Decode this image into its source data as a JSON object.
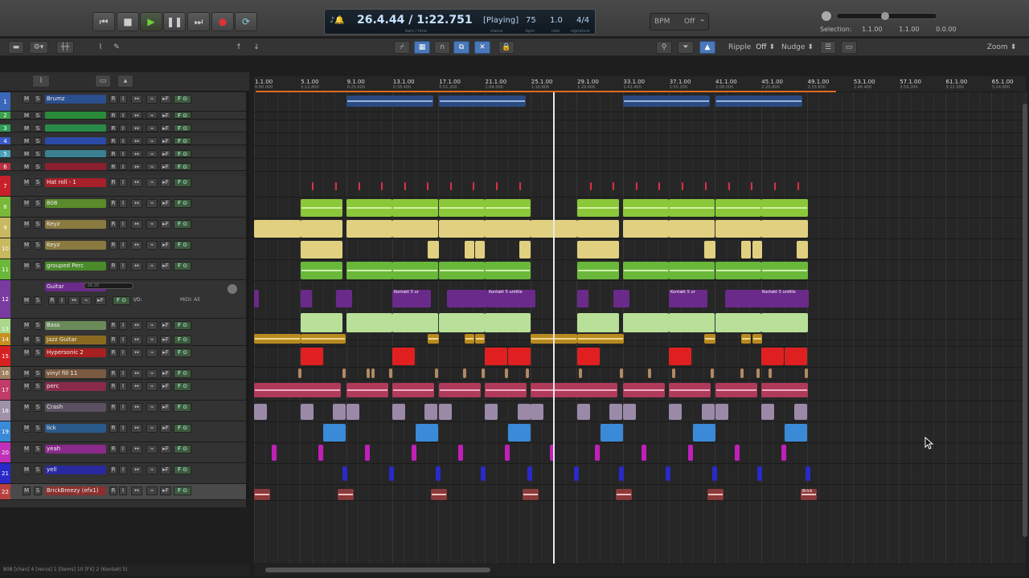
{
  "transport": {
    "rewind_icon": "rewind-icon",
    "stop_icon": "stop-icon",
    "play_icon": "play-icon",
    "pause_icon": "pause-icon",
    "forward_icon": "forward-icon",
    "record_icon": "record-icon",
    "loop_icon": "loop-icon",
    "time": "26.4.44 / 1:22.751",
    "time_sub": "bars / time",
    "status": "[Playing]",
    "status_lbl": "status",
    "bpm": "75",
    "bpm_lbl": "bpm",
    "rate": "1.0",
    "rate_lbl": "rate",
    "signature": "4/4",
    "signature_lbl": "signature",
    "bpm_btn": "BPM",
    "bpm_mode": "Off",
    "selection_label": "Selection:",
    "sel_start": "1.1.00",
    "sel_end": "1.1.00",
    "sel_len": "0.0.00"
  },
  "toolbar": {
    "ripple": "Ripple",
    "ripple_val": "Off",
    "nudge": "Nudge",
    "zoom": "Zoom"
  },
  "tracks": [
    {
      "num": "1",
      "name": "Brumz",
      "color": "#3a67b8",
      "namebg": "#2a4e8e"
    },
    {
      "num": "2",
      "name": "",
      "color": "#3aa04a",
      "namebg": "#2a8a3a"
    },
    {
      "num": "3",
      "name": "",
      "color": "#2f9a5a",
      "namebg": "#2a8a4a"
    },
    {
      "num": "4",
      "name": "",
      "color": "#3a5ac8",
      "namebg": "#2a4aa8"
    },
    {
      "num": "5",
      "name": "",
      "color": "#4aa0b8",
      "namebg": "#3a8090"
    },
    {
      "num": "6",
      "name": "",
      "color": "#b83040",
      "namebg": "#8a2030"
    },
    {
      "num": "7",
      "name": "Hat roll - 1",
      "color": "#c8202a",
      "namebg": "#a8202a"
    },
    {
      "num": "8",
      "name": "808",
      "color": "#7ab83a",
      "namebg": "#5a8a2a"
    },
    {
      "num": "9",
      "name": "Keyz",
      "color": "#c8b860",
      "namebg": "#8a7a40"
    },
    {
      "num": "10",
      "name": "Keyz",
      "color": "#c8b860",
      "namebg": "#8a7a40"
    },
    {
      "num": "11",
      "name": "grouped Perc",
      "color": "#6ab83a",
      "namebg": "#4a8a2a"
    },
    {
      "num": "12",
      "name": "Guitar",
      "color": "#7a3aa0",
      "namebg": "#6a2a8a"
    },
    {
      "num": "13",
      "name": "Bass",
      "color": "#a8d888",
      "namebg": "#6a8a5a"
    },
    {
      "num": "14",
      "name": "Jazz Guitar",
      "color": "#c89020",
      "namebg": "#8a6a20"
    },
    {
      "num": "15",
      "name": "Hypersonic 2",
      "color": "#d82020",
      "namebg": "#a82020"
    },
    {
      "num": "16",
      "name": "vinyl fill 11",
      "color": "#a08060",
      "namebg": "#7a5a40"
    },
    {
      "num": "17",
      "name": "perc",
      "color": "#c03a6a",
      "namebg": "#8a2a4a"
    },
    {
      "num": "18",
      "name": "Crash",
      "color": "#a090a8",
      "namebg": "#5a5060"
    },
    {
      "num": "19",
      "name": "lick",
      "color": "#3a8ad8",
      "namebg": "#2a5a8a"
    },
    {
      "num": "20",
      "name": "yeah",
      "color": "#c030b8",
      "namebg": "#8a2a8a"
    },
    {
      "num": "21",
      "name": "yell",
      "color": "#2a2ac8",
      "namebg": "#2a2aa0"
    },
    {
      "num": "22",
      "name": "BrickBreezy (efx1)",
      "color": "#b84040",
      "namebg": "#8a3030"
    }
  ],
  "ruler": [
    {
      "bar": "1.1.00",
      "time": "0:00.000"
    },
    {
      "bar": "5.1.00",
      "time": "0:12.800"
    },
    {
      "bar": "9.1.00",
      "time": "0:25.600"
    },
    {
      "bar": "13.1.00",
      "time": "0:38.400"
    },
    {
      "bar": "17.1.00",
      "time": "0:51.200"
    },
    {
      "bar": "21.1.00",
      "time": "1:04.000"
    },
    {
      "bar": "25.1.00",
      "time": "1:16.800"
    },
    {
      "bar": "29.1.00",
      "time": "1:29.600"
    },
    {
      "bar": "33.1.00",
      "time": "1:42.400"
    },
    {
      "bar": "37.1.00",
      "time": "1:55.200"
    },
    {
      "bar": "41.1.00",
      "time": "2:08.000"
    },
    {
      "bar": "45.1.00",
      "time": "2:20.800"
    },
    {
      "bar": "49.1.00",
      "time": "2:33.600"
    },
    {
      "bar": "53.1.00",
      "time": "2:46.400"
    },
    {
      "bar": "57.1.00",
      "time": "2:59.200"
    },
    {
      "bar": "61.1.00",
      "time": "3:12.000"
    },
    {
      "bar": "65.1.00",
      "time": "3:24.800"
    }
  ],
  "clip_labels": {
    "kontakt1": "Kontakt 5 ur",
    "kontakt2": "Kontakt 5 untitle",
    "brick": "Brick"
  },
  "guitar_track": {
    "io": "I/O:",
    "midi": "MIDI: All",
    "vol": "-26.20"
  },
  "statusbar": "808 [chan] 4 [recvs] 1 [items] 10 [FX] 2 (Kontakt 5)"
}
